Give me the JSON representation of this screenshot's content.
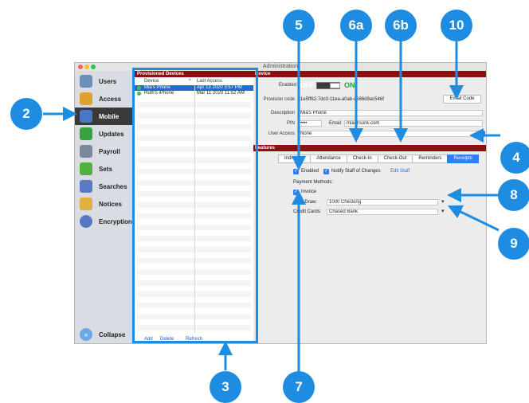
{
  "callouts": {
    "c2": "2",
    "c3": "3",
    "c4": "4",
    "c5": "5",
    "c6a": "6a",
    "c6b": "6b",
    "c7": "7",
    "c8": "8",
    "c9": "9",
    "c10": "10"
  },
  "window": {
    "title": "Administration"
  },
  "nav": [
    {
      "label": "Users",
      "icon": "users-icon",
      "color": "#6a8fb8"
    },
    {
      "label": "Access",
      "icon": "key-icon",
      "color": "#e0a030"
    },
    {
      "label": "Mobile",
      "icon": "phone-icon",
      "color": "#4a78c8"
    },
    {
      "label": "Updates",
      "icon": "download-icon",
      "color": "#3aa040"
    },
    {
      "label": "Payroll",
      "icon": "pen-icon",
      "color": "#7a8a9a"
    },
    {
      "label": "Sets",
      "icon": "braces-icon",
      "color": "#50b040"
    },
    {
      "label": "Searches",
      "icon": "magnifier-icon",
      "color": "#5a7ac8"
    },
    {
      "label": "Notices",
      "icon": "notice-icon",
      "color": "#e0b040"
    },
    {
      "label": "Encryption",
      "icon": "lock-shield-icon",
      "color": "#5a78c0"
    }
  ],
  "collapse_label": "Collapse",
  "devices": {
    "header": "Provisioned Devices",
    "col_device": "Device",
    "col_access": "Last Access",
    "rows": [
      {
        "name": "Mia's Phone",
        "access": "Apr 13 2020 3:57 PM"
      },
      {
        "name": "Ruth's iPhone",
        "access": "Mar 11 2020 11:52 AM"
      }
    ],
    "add": "Add",
    "delete": "Delete",
    "refresh": "Refresh"
  },
  "device": {
    "header": "Device",
    "enabled_label": "Enabled",
    "off": "OFF",
    "on": "ON",
    "provision_label": "Provision code",
    "provision_value": "c1e5ff62-7dc0-11ea-a0ab-c686d9ac546f",
    "email_code_button": "Email Code",
    "description_label": "Description",
    "description_value": "Mia's Phone",
    "pin_label": "PIN",
    "pin_value": "••••",
    "email_label": "Email",
    "email_value": "mia@sunk.com",
    "user_access_label": "User Access",
    "user_access_value": "None"
  },
  "features": {
    "header": "Features",
    "tabs": [
      "Individual",
      "Attendance",
      "Check-In",
      "Check-Out",
      "Reminders",
      "Receipts"
    ],
    "enabled_label": "Enabled",
    "notify_label": "Notify Staff of Changes",
    "edit_staff_link": "Edit Staff",
    "payment_methods_label": "Payment Methods:",
    "invoice_label": "Invoice",
    "auto_draw_label": "Auto-Draw:",
    "auto_draw_value": "1000 Checking",
    "credit_cards_label": "Credit Cards:",
    "credit_cards_value": "Chased Bank"
  },
  "colors": {
    "callout": "#1e8ce0",
    "header_red": "#8b1010",
    "accent_blue": "#2f7ff0"
  }
}
